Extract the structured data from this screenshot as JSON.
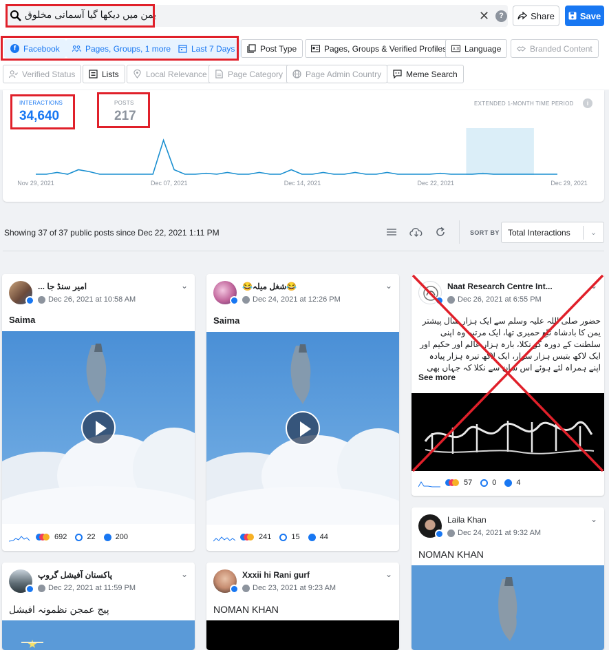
{
  "search": {
    "query": "یمن میں دیکھا گیا آسمانی مخلوق"
  },
  "header": {
    "share_label": "Share",
    "save_label": "Save",
    "help_glyph": "?",
    "clear_glyph": "✕"
  },
  "filters": {
    "row1": [
      {
        "label": "Facebook",
        "icon": "facebook-icon",
        "active": true
      },
      {
        "label": "Pages, Groups, 1 more",
        "icon": "people-icon",
        "active": true
      },
      {
        "label": "Last 7 Days",
        "icon": "calendar-icon",
        "active": true
      },
      {
        "label": "Post Type",
        "icon": "post-type-icon",
        "active": false
      },
      {
        "label": "Pages, Groups & Verified Profiles",
        "icon": "id-card-icon",
        "active": false
      },
      {
        "label": "Language",
        "icon": "language-icon",
        "active": false
      },
      {
        "label": "Branded Content",
        "icon": "handshake-icon",
        "disabled": true
      }
    ],
    "row2": [
      {
        "label": "Verified Status",
        "icon": "verified-user-icon",
        "disabled": true
      },
      {
        "label": "Lists",
        "icon": "list-icon",
        "active": false
      },
      {
        "label": "Local Relevance",
        "icon": "location-pin-icon",
        "disabled": true
      },
      {
        "label": "Page Category",
        "icon": "document-icon",
        "disabled": true
      },
      {
        "label": "Page Admin Country",
        "icon": "globe-icon",
        "disabled": true
      },
      {
        "label": "Meme Search",
        "icon": "meme-icon",
        "active": false
      }
    ]
  },
  "stats": {
    "interactions_label": "INTERACTIONS",
    "interactions_value": "34,640",
    "posts_label": "POSTS",
    "posts_value": "217",
    "extended_label": "EXTENDED 1-MONTH TIME PERIOD",
    "info_glyph": "i"
  },
  "chart_data": {
    "type": "line",
    "x_tick_labels": [
      "Nov 29, 2021",
      "Dec 07, 2021",
      "Dec 14, 2021",
      "Dec 22, 2021",
      "Dec 29, 2021"
    ],
    "series": [
      {
        "values": [
          0,
          0,
          2,
          0,
          5,
          3,
          0,
          0,
          0,
          0,
          0,
          0,
          38,
          5,
          0,
          0,
          1,
          0,
          2,
          0,
          0,
          2,
          0,
          0,
          5,
          0,
          0,
          2,
          0,
          0,
          2,
          0,
          0,
          2,
          0,
          0,
          0,
          0,
          1,
          0,
          0,
          0,
          1,
          0,
          0,
          0,
          0,
          0,
          0,
          0
        ]
      }
    ],
    "ylim": [
      0,
      40
    ],
    "highlight_range": [
      0.825,
      0.955
    ],
    "line_color": "#1a8fd0",
    "highlight_color": "#dbeef8"
  },
  "results": {
    "showing_text": "Showing 37 of 37 public posts since Dec 22, 2021 1:11 PM",
    "sort_label": "SORT BY",
    "sort_value": "Total Interactions"
  },
  "posts": [
    {
      "account": "امیر سنڈ جا ...",
      "date": "Dec 26, 2021 at 10:58 AM",
      "message": "Saima",
      "reactions": "692",
      "comments": "22",
      "shares": "200"
    },
    {
      "account": "😂شغل میلہ😂",
      "date": "Dec 24, 2021 at 12:26 PM",
      "message": "Saima",
      "reactions": "241",
      "comments": "15",
      "shares": "44"
    },
    {
      "account": "Naat Research Centre Int...",
      "date": "Dec 26, 2021 at 6:55 PM",
      "message": "حضور صلی اللہ علیہ وسلم سے ایک ہزار سال پیشتر یمن کا بادشاہ تُبّع حمیری تھا، ایک مرتبہ وہ اپنی سلطنت کے دورہ کو نکلا، بارہ ہزار عالم اور حکیم اور ایک لاکھ بتیس ہزار سوار، ایک لاکھ تیرہ ہزار پیادہ اپنے ہمراہ لئے ہوئے اس شان سے نکلا کہ جہاں بھی",
      "see_more": "See more",
      "reactions": "57",
      "comments": "0",
      "shares": "4"
    },
    {
      "account": "Laila Khan",
      "date": "Dec 24, 2021 at 9:32 AM",
      "message": "NOMAN KHAN"
    },
    {
      "account": "پاکستان آفیشل گروپ",
      "date": "Dec 22, 2021 at 11:59 PM",
      "message": "پیج عمجن نظمونہ افیشل"
    },
    {
      "account": "Xxxii hi Rani gurf",
      "date": "Dec 23, 2021 at 9:23 AM",
      "message": "NOMAN KHAN"
    }
  ]
}
